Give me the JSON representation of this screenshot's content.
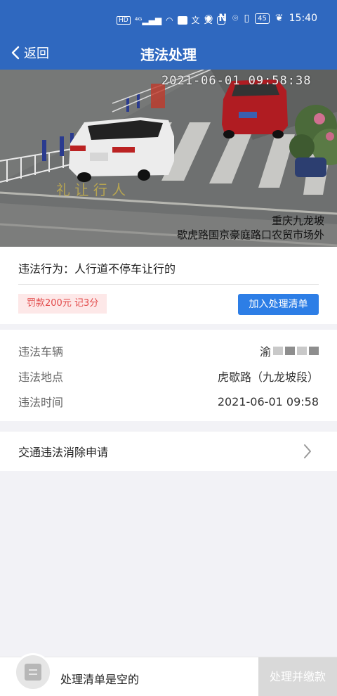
{
  "status_bar": {
    "left_icons": [
      "hd-icon",
      "signal-4g-icon",
      "wifi-icon",
      "app-icon",
      "wen-icon",
      "wen-icon",
      "app2-icon"
    ],
    "right_icons": [
      "eye-icon",
      "nfc-icon",
      "location-icon",
      "vibrate-icon",
      "battery-icon",
      "leaf-icon"
    ],
    "battery": "45",
    "time": "15:40"
  },
  "navbar": {
    "back_label": "返回",
    "title": "违法处理"
  },
  "camera": {
    "timestamp": "2021-06-01 09:58:38",
    "location_line1": "重庆九龙坡",
    "location_line2": "歇虎路国京豪庭路口农贸市场外"
  },
  "violation": {
    "text": "违法行为：人行道不停车让行的",
    "fine": "罚款200元 记3分",
    "add_button": "加入处理清单"
  },
  "details": {
    "vehicle_label": "违法车辆",
    "vehicle_value": "渝",
    "location_label": "违法地点",
    "location_value": "虎歇路（九龙坡段）",
    "time_label": "违法时间",
    "time_value": "2021-06-01 09:58"
  },
  "appeal": {
    "label": "交通违法消除申请"
  },
  "bottom": {
    "empty_text": "处理清单是空的",
    "pay_button": "处理并缴款"
  },
  "colors": {
    "brand_blue": "#2f68bf",
    "button_blue": "#2d7ee6",
    "fine_red": "#e24a4a"
  }
}
